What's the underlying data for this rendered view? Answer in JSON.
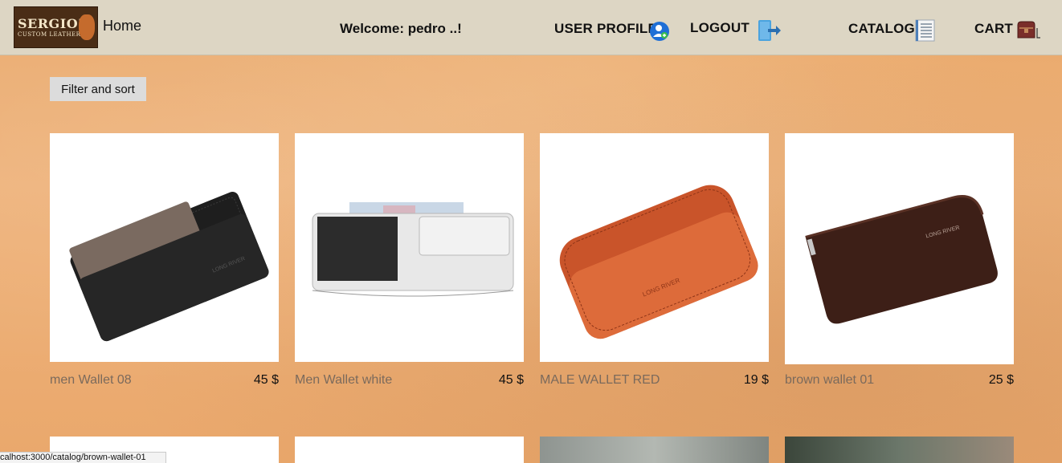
{
  "header": {
    "logo_line1": "SERGIO'S",
    "logo_line2": "CUSTOM LEATHER",
    "home": "Home",
    "welcome": "Welcome: pedro ..!",
    "user_profile": "USER PROFILE",
    "logout": "LOGOUT",
    "catalog": "CATALOG",
    "cart": "CART"
  },
  "toolbar": {
    "filter_sort": "Filter and sort"
  },
  "products": [
    {
      "name": "men Wallet 08",
      "price": "45 $"
    },
    {
      "name": "Men Wallet white",
      "price": "45 $"
    },
    {
      "name": "MALE WALLET RED",
      "price": "19 $"
    },
    {
      "name": "brown wallet 01",
      "price": "25 $"
    }
  ],
  "status_url": "calhost:3000/catalog/brown-wallet-01",
  "colors": {
    "navbar_bg": "#ddd6c4",
    "page_bg": "#eaa86c",
    "product_name": "#7b6a5c"
  }
}
